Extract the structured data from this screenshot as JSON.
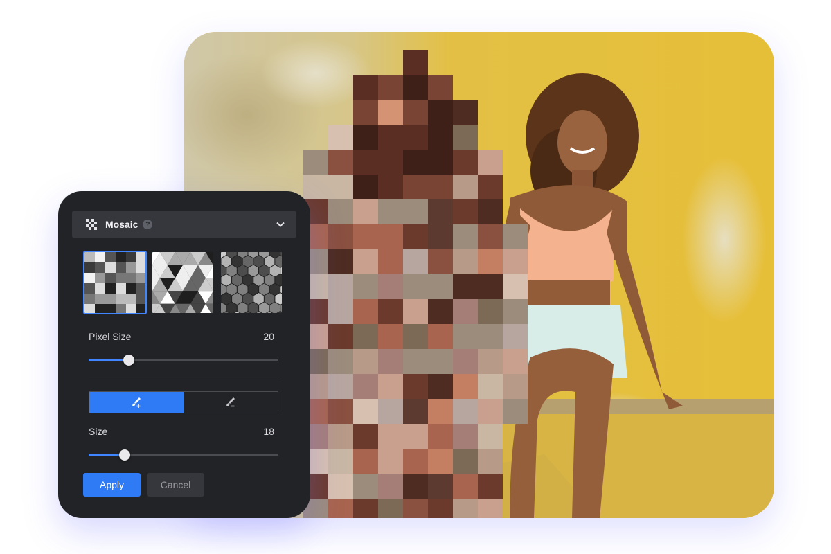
{
  "panel": {
    "effect_title": "Mosaic",
    "help_icon": "help-circle-icon",
    "dropdown_icon": "chevron-down-icon",
    "effect_icon": "checkerboard-icon",
    "styles": [
      {
        "name": "square-mosaic",
        "selected": true
      },
      {
        "name": "triangle-mosaic",
        "selected": false
      },
      {
        "name": "hexagon-mosaic",
        "selected": false
      }
    ],
    "pixel_size": {
      "label": "Pixel Size",
      "value": "20",
      "fraction": 0.21
    },
    "brush_modes": [
      {
        "icon": "brush-add-icon",
        "active": true
      },
      {
        "icon": "brush-erase-icon",
        "active": false
      }
    ],
    "brush_size": {
      "label": "Size",
      "value": "18",
      "fraction": 0.19
    },
    "apply_label": "Apply",
    "cancel_label": "Cancel"
  },
  "colors": {
    "accent": "#2f7bf5",
    "panel_bg": "#222326",
    "wall_yellow": "#e2bd3e"
  }
}
